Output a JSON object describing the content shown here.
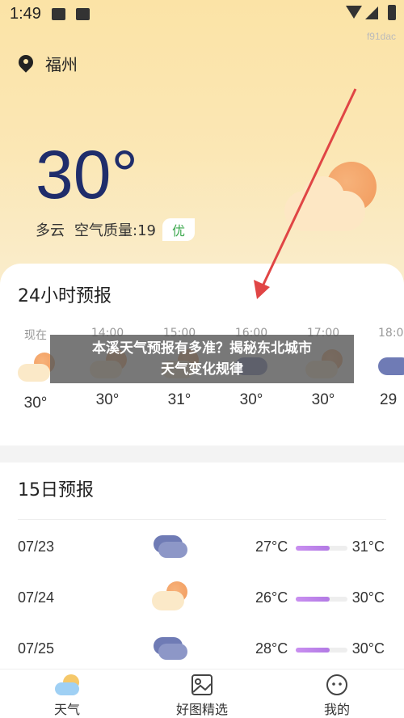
{
  "status_bar": {
    "time": "1:49",
    "watermark": "f91dac"
  },
  "location": {
    "city": "福州"
  },
  "current": {
    "temperature": "30°",
    "condition": "多云",
    "air_quality_label": "空气质量:19",
    "air_quality_level": "优"
  },
  "hourly": {
    "title": "24小时预报",
    "items": [
      {
        "time": "现在",
        "temp": "30°",
        "icon": "cloud-sun-icon"
      },
      {
        "time": "14:00",
        "temp": "30°",
        "icon": "cloud-sun-icon"
      },
      {
        "time": "15:00",
        "temp": "31°",
        "icon": "cloud-sun-icon"
      },
      {
        "time": "16:00",
        "temp": "30°",
        "icon": "dark-cloud-icon"
      },
      {
        "time": "17:00",
        "temp": "30°",
        "icon": "cloud-sun-icon"
      },
      {
        "time": "18:0",
        "temp": "29",
        "icon": "dark-cloud-icon"
      }
    ]
  },
  "overlay": {
    "line1": "本溪天气预报有多准？揭秘东北城市",
    "line2": "天气变化规律"
  },
  "daily": {
    "title": "15日预报",
    "items": [
      {
        "date": "07/23",
        "low": "27°C",
        "high": "31°C",
        "icon": "rain-cloud-icon",
        "range": [
          0.0,
          0.65
        ]
      },
      {
        "date": "07/24",
        "low": "26°C",
        "high": "30°C",
        "icon": "cloud-sun-icon",
        "range": [
          0.0,
          0.65
        ]
      },
      {
        "date": "07/25",
        "low": "28°C",
        "high": "30°C",
        "icon": "rain-cloud-icon",
        "range": [
          0.0,
          0.65
        ]
      }
    ]
  },
  "tabs": [
    {
      "label": "天气",
      "icon": "weather-icon"
    },
    {
      "label": "好图精选",
      "icon": "image-icon"
    },
    {
      "label": "我的",
      "icon": "profile-icon"
    }
  ],
  "colors": {
    "temp_text": "#1f2d6b",
    "aq_good": "#3ca84e",
    "arrow": "#e04545",
    "bar": "#b27ae4"
  }
}
